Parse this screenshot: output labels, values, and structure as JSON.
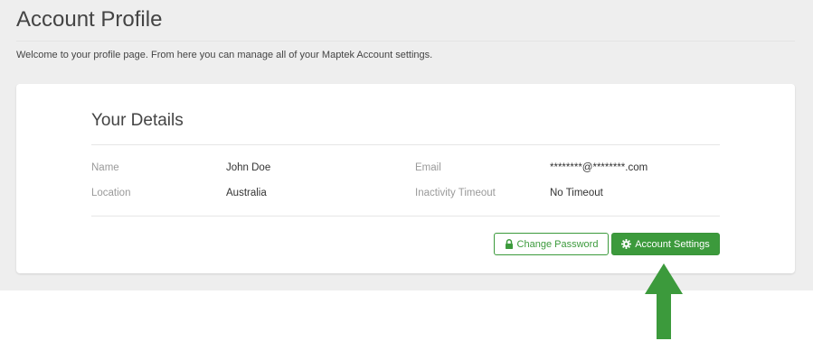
{
  "page": {
    "title": "Account Profile",
    "intro": "Welcome to your profile page. From here you can manage all of your Maptek Account settings."
  },
  "details": {
    "heading": "Your Details",
    "name_label": "Name",
    "name_value": "John Doe",
    "email_label": "Email",
    "email_value": "********@********.com",
    "location_label": "Location",
    "location_value": "Australia",
    "timeout_label": "Inactivity Timeout",
    "timeout_value": "No Timeout"
  },
  "actions": {
    "change_password_label": "Change Password",
    "change_password_icon": "lock-icon",
    "account_settings_label": "Account Settings",
    "account_settings_icon": "gear-icon"
  },
  "annotation": {
    "arrow_icon": "arrow-up-icon",
    "arrow_color": "#3c9a3c"
  },
  "colors": {
    "accent": "#3c9a3c",
    "page_background": "#eeeeee",
    "card_background": "#ffffff"
  }
}
